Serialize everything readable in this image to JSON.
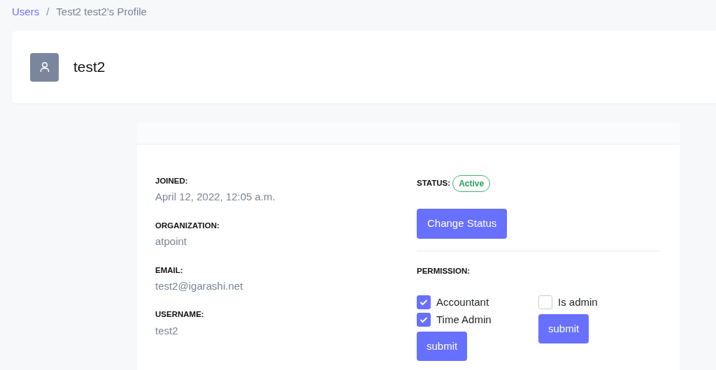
{
  "breadcrumb": [
    {
      "label": "Users",
      "kind": "link"
    },
    {
      "label": "/",
      "kind": "separator"
    },
    {
      "label": "Test2 test2's Profile",
      "kind": "current"
    }
  ],
  "profile": {
    "name": "test2"
  },
  "details": [
    {
      "label": "JOINED:",
      "value": "April 12, 2022, 12:05 a.m."
    },
    {
      "label": "ORGANIZATION:",
      "value": "atpoint"
    },
    {
      "label": "EMAIL:",
      "value": "test2@igarashi.net"
    },
    {
      "label": "USERNAME:",
      "value": "test2"
    }
  ],
  "status": {
    "label": "STATUS:",
    "badge": "Active",
    "button": "Change Status"
  },
  "permission": {
    "label": "PERMISSION:",
    "groups": [
      {
        "options": [
          {
            "label": "Accountant",
            "checked": true
          },
          {
            "label": "Time Admin",
            "checked": true
          }
        ],
        "button": "submit"
      },
      {
        "options": [
          {
            "label": "Is admin",
            "checked": false
          }
        ],
        "button": "submit"
      }
    ]
  }
}
